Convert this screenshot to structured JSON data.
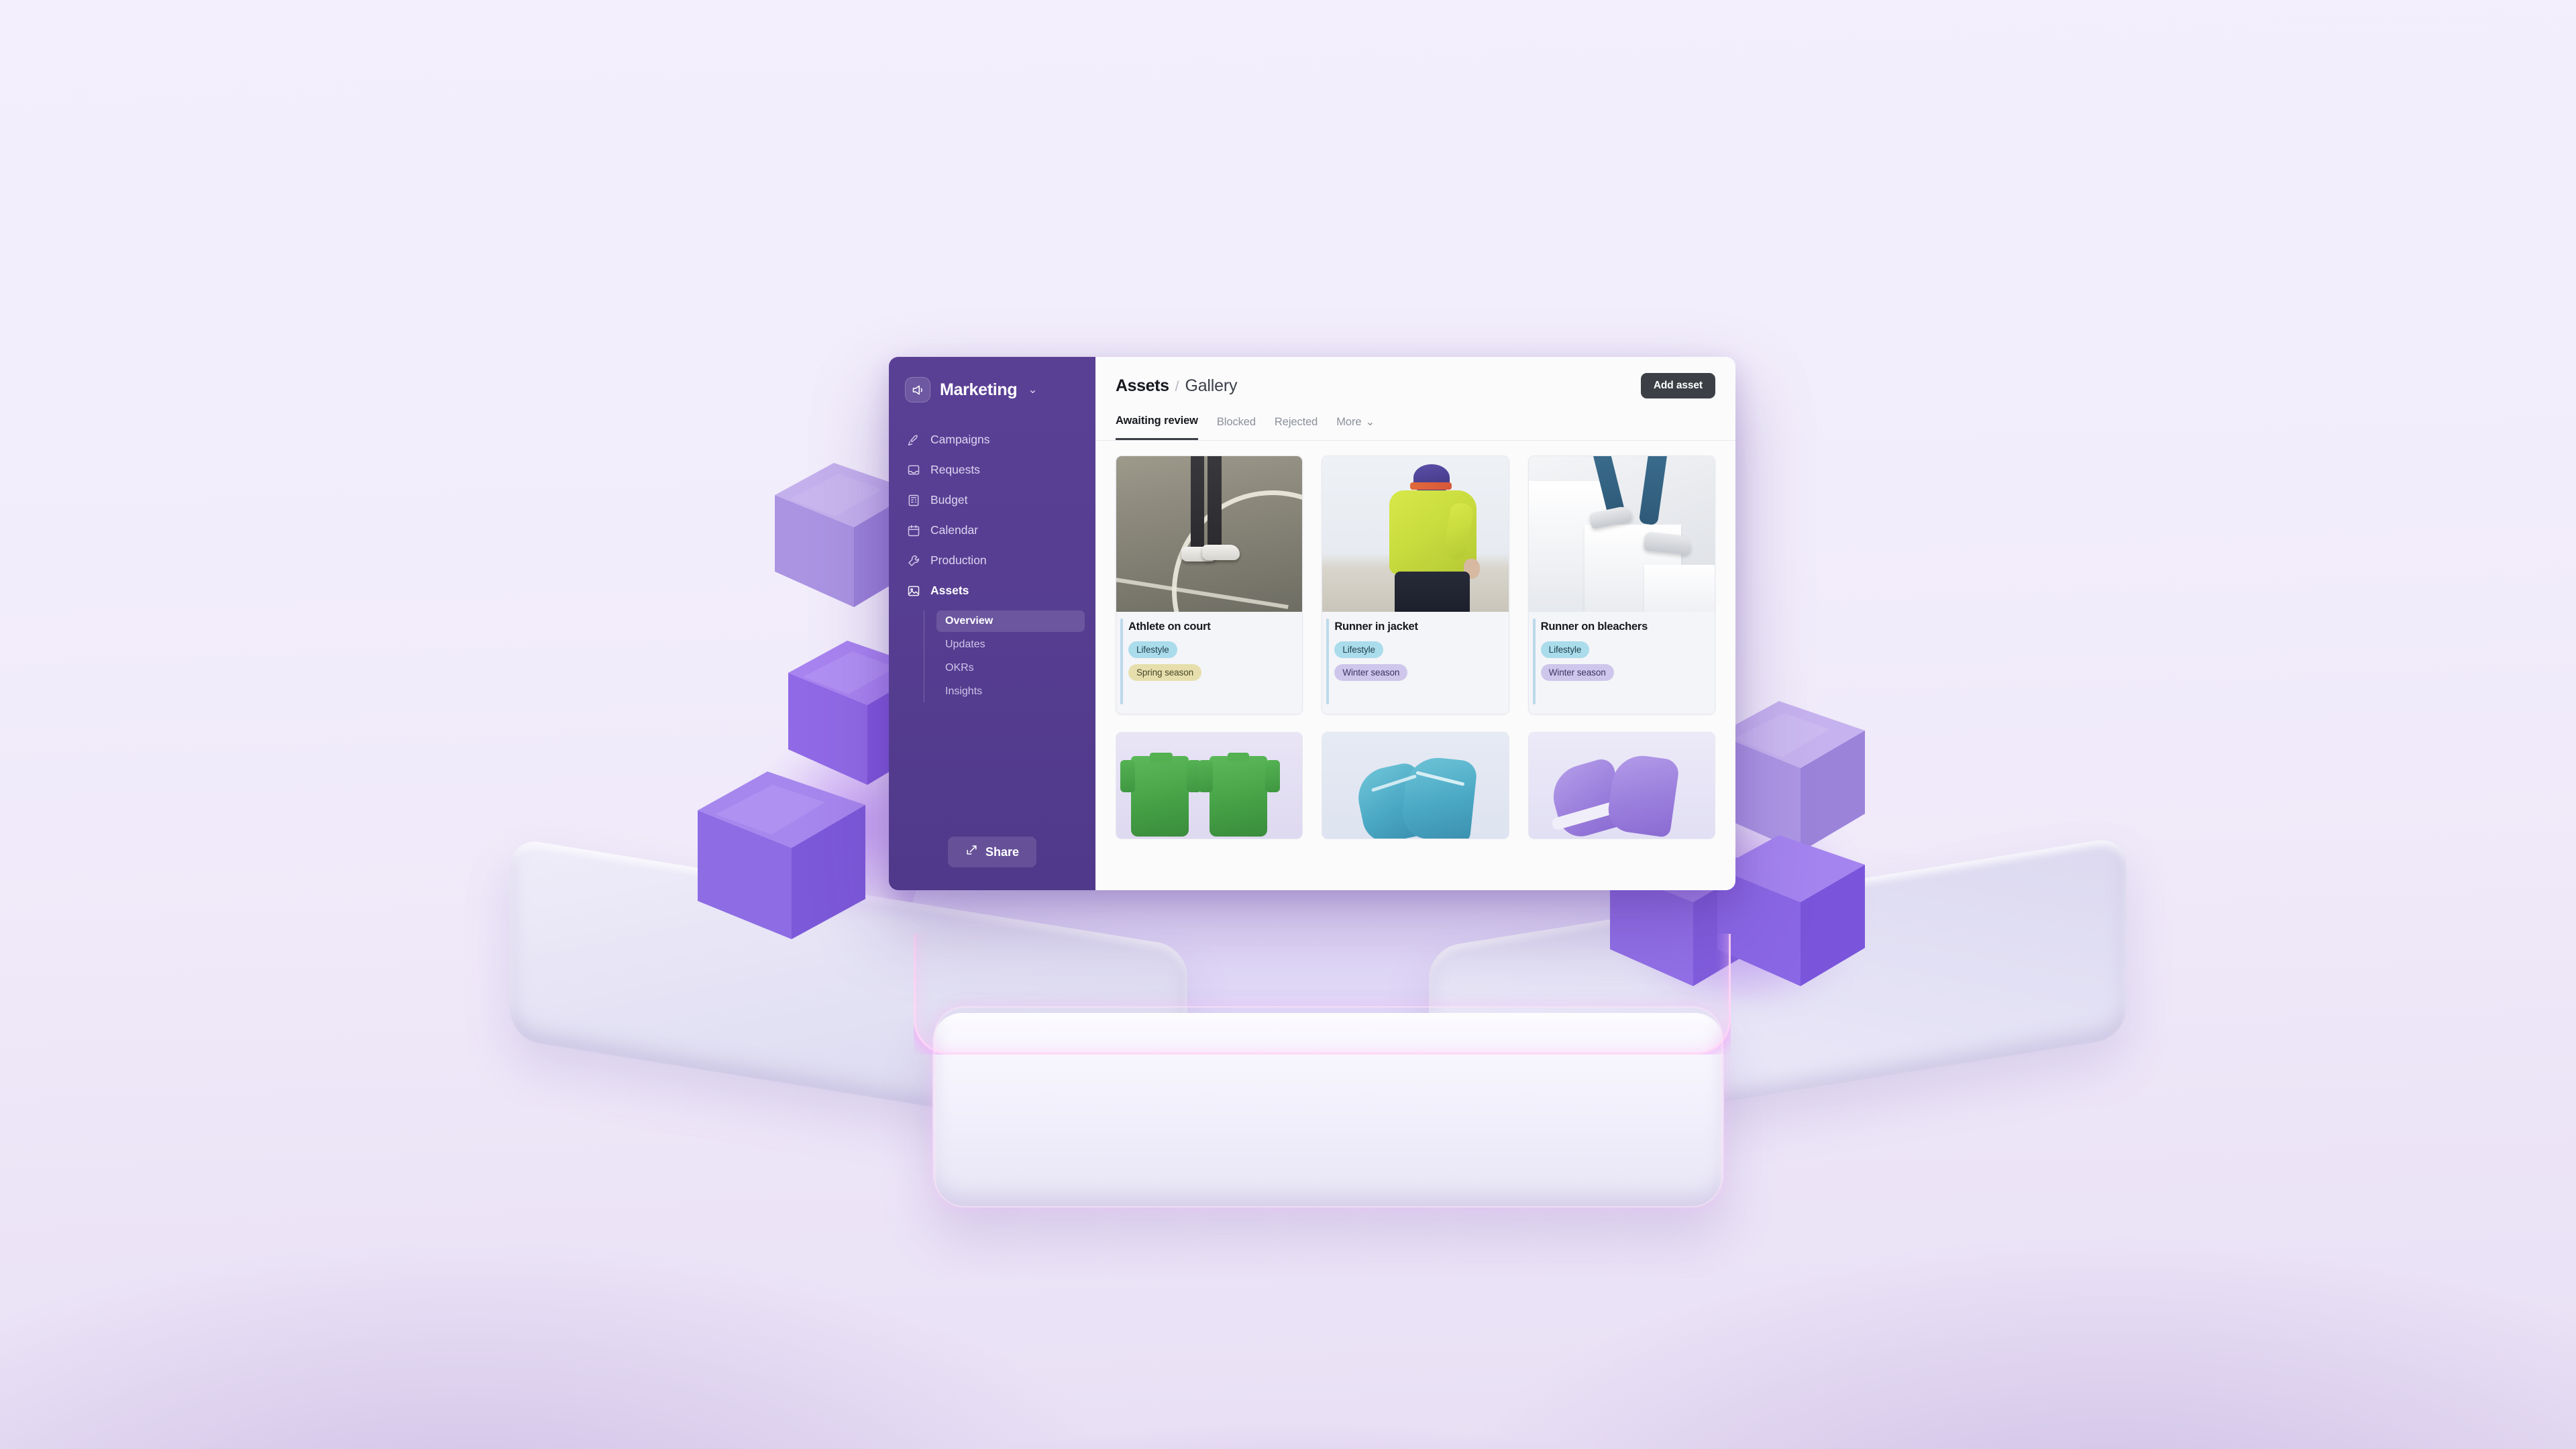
{
  "sidebar": {
    "workspace": {
      "name": "Marketing",
      "icon": "megaphone-icon",
      "chevron": "⌄"
    },
    "items": [
      {
        "label": "Campaigns",
        "icon": "rocket-icon",
        "active": false
      },
      {
        "label": "Requests",
        "icon": "inbox-icon",
        "active": false
      },
      {
        "label": "Budget",
        "icon": "ledger-icon",
        "active": false
      },
      {
        "label": "Calendar",
        "icon": "calendar-icon",
        "active": false
      },
      {
        "label": "Production",
        "icon": "wrench-icon",
        "active": false
      },
      {
        "label": "Assets",
        "icon": "image-icon",
        "active": true
      }
    ],
    "subitems": [
      {
        "label": "Overview",
        "active": true
      },
      {
        "label": "Updates",
        "active": false
      },
      {
        "label": "OKRs",
        "active": false
      },
      {
        "label": "Insights",
        "active": false
      }
    ],
    "share": {
      "label": "Share",
      "icon": "share-icon"
    }
  },
  "header": {
    "breadcrumb_parent": "Assets",
    "breadcrumb_sep": "/",
    "breadcrumb_current": "Gallery",
    "add_asset_label": "Add asset"
  },
  "tabs": [
    {
      "label": "Awaiting review",
      "active": true
    },
    {
      "label": "Blocked",
      "active": false
    },
    {
      "label": "Rejected",
      "active": false
    },
    {
      "label": "More",
      "active": false,
      "chevron": "⌄"
    }
  ],
  "cards": [
    {
      "title": "Athlete  on court",
      "photo": "athlete-on-court-photo",
      "tags": [
        {
          "label": "Lifestyle",
          "style": "lifestyle"
        },
        {
          "label": "Spring season",
          "style": "spring"
        }
      ]
    },
    {
      "title": "Runner in jacket",
      "photo": "runner-in-jacket-photo",
      "tags": [
        {
          "label": "Lifestyle",
          "style": "lifestyle"
        },
        {
          "label": "Winter season",
          "style": "winter"
        }
      ]
    },
    {
      "title": "Runner on bleachers",
      "photo": "runner-on-bleachers-photo",
      "tags": [
        {
          "label": "Lifestyle",
          "style": "lifestyle"
        },
        {
          "label": "Winter season",
          "style": "winter"
        }
      ]
    }
  ],
  "second_row": [
    {
      "photo": "green-polo-shirts-photo"
    },
    {
      "photo": "teal-knit-sneakers-photo"
    },
    {
      "photo": "purple-sneakers-photo"
    }
  ],
  "colors": {
    "sidebar_purple": "#573e92",
    "add_button_dark": "#3c4046",
    "tag_lifestyle": "#aadcec",
    "tag_spring": "#e6dfad",
    "tag_winter": "#cfc6ec",
    "cube_purple": "#8b5cf6",
    "scene_background": "#f2eefb",
    "glow_purple": "#9648eb"
  },
  "scene": {
    "cubes": [
      {
        "name": "floating-cube-left-top",
        "shade": "light"
      },
      {
        "name": "stacked-cube-left-mid",
        "shade": "mid"
      },
      {
        "name": "stacked-cube-left-bottom",
        "shade": "mid"
      },
      {
        "name": "stacked-cube-right-top",
        "shade": "light"
      },
      {
        "name": "stacked-cube-right-left",
        "shade": "mid"
      },
      {
        "name": "stacked-cube-right-front",
        "shade": "mid"
      }
    ],
    "platforms": [
      "slab-left",
      "slab-right",
      "slab-front",
      "slab-back"
    ]
  }
}
